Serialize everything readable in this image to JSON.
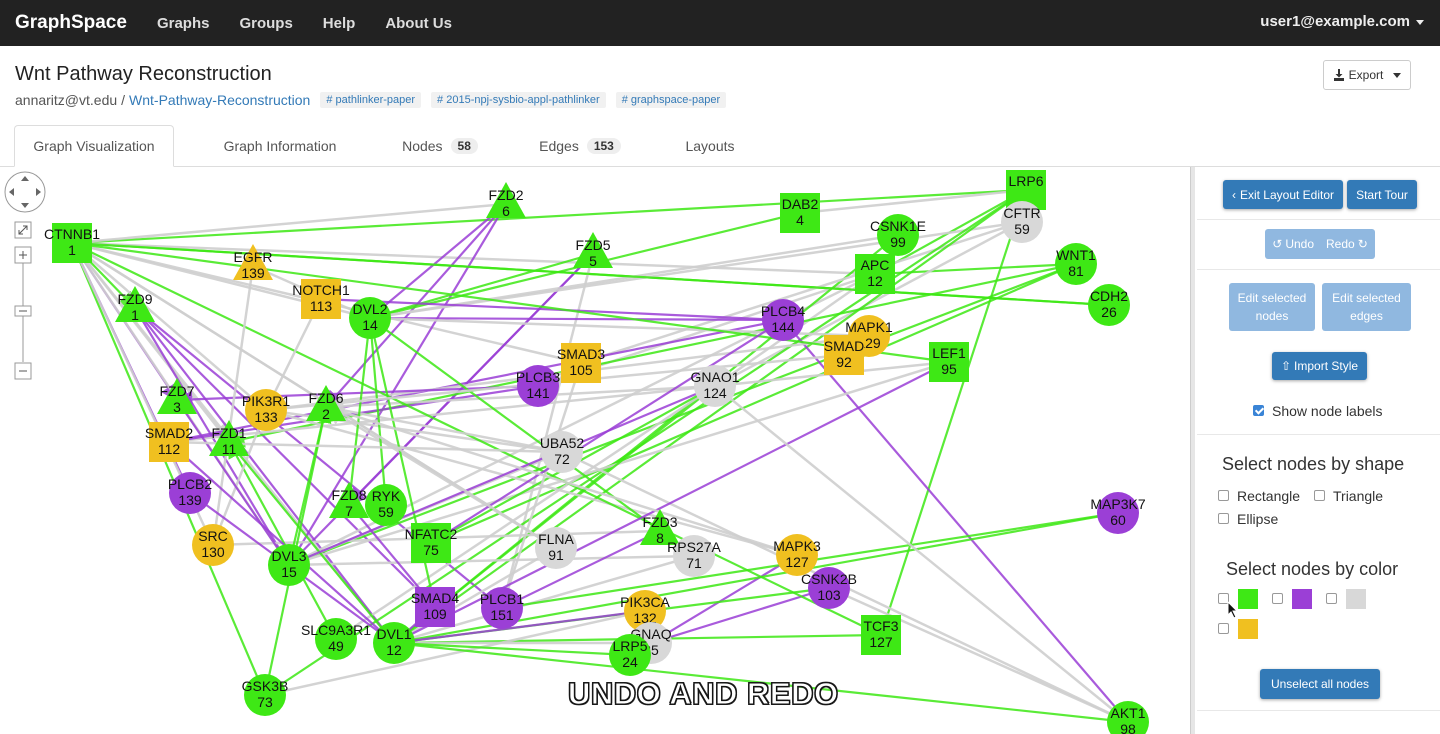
{
  "nav": {
    "brand": "GraphSpace",
    "links": [
      "Graphs",
      "Groups",
      "Help",
      "About Us"
    ],
    "user": "user1@example.com"
  },
  "header": {
    "title": "Wnt Pathway Reconstruction",
    "owner": "annaritz@vt.edu",
    "separator": "/",
    "graph_link": "Wnt-Pathway-Reconstruction",
    "tags": [
      "pathlinker-paper",
      "2015-npj-sysbio-appl-pathlinker",
      "graphspace-paper"
    ],
    "export_label": "Export"
  },
  "tabs": {
    "viz": "Graph Visualization",
    "info": "Graph Information",
    "nodes": "Nodes",
    "nodes_count": "58",
    "edges": "Edges",
    "edges_count": "153",
    "layouts": "Layouts"
  },
  "panel": {
    "exit_layout": "Exit Layout Editor",
    "start_tour": "Start Tour",
    "undo": "Undo",
    "redo": "Redo",
    "edit_nodes": "Edit selected nodes",
    "edit_edges": "Edit selected edges",
    "import_style": "Import Style",
    "show_labels": "Show node labels",
    "shape_title": "Select nodes by shape",
    "shape_rect": "Rectangle",
    "shape_tri": "Triangle",
    "shape_ellipse": "Ellipse",
    "color_title": "Select nodes by color",
    "colors": [
      "#3ee815",
      "#9b3fd6",
      "#d8d8d8",
      "#f0c020"
    ],
    "unselect": "Unselect all nodes"
  },
  "overlay": "UNDO AND REDO",
  "graph": {
    "colors": {
      "green": "#3ee815",
      "purple": "#9b3fd6",
      "gray": "#d8d8d8",
      "yellow": "#f0c020"
    },
    "nodes": [
      {
        "id": "CTNNB1",
        "num": "1",
        "shape": "rect",
        "color": "green"
      },
      {
        "id": "FZD2",
        "num": "6",
        "shape": "tri",
        "color": "green"
      },
      {
        "id": "DAB2",
        "num": "4",
        "shape": "rect",
        "color": "green"
      },
      {
        "id": "LRP6",
        "num": "",
        "shape": "rect",
        "color": "green"
      },
      {
        "id": "CFTR",
        "num": "59",
        "shape": "ellipse",
        "color": "gray"
      },
      {
        "id": "CSNK1E",
        "num": "99",
        "shape": "ellipse",
        "color": "green"
      },
      {
        "id": "EGFR",
        "num": "139",
        "shape": "tri",
        "color": "yellow"
      },
      {
        "id": "FZD5",
        "num": "5",
        "shape": "tri",
        "color": "green"
      },
      {
        "id": "APC",
        "num": "12",
        "shape": "rect",
        "color": "green"
      },
      {
        "id": "WNT1",
        "num": "81",
        "shape": "ellipse",
        "color": "green"
      },
      {
        "id": "FZD9",
        "num": "1",
        "shape": "tri",
        "color": "green"
      },
      {
        "id": "NOTCH1",
        "num": "113",
        "shape": "rect",
        "color": "yellow"
      },
      {
        "id": "DVL2",
        "num": "14",
        "shape": "ellipse",
        "color": "green"
      },
      {
        "id": "CDH2",
        "num": "26",
        "shape": "ellipse",
        "color": "green"
      },
      {
        "id": "PLCB4",
        "num": "144",
        "shape": "ellipse",
        "color": "purple"
      },
      {
        "id": "MAPK1",
        "num": "129",
        "shape": "ellipse",
        "color": "yellow"
      },
      {
        "id": "SMAD3",
        "num": "105",
        "shape": "rect",
        "color": "yellow"
      },
      {
        "id": "SMAD",
        "num": "92",
        "shape": "rect",
        "color": "yellow"
      },
      {
        "id": "LEF1",
        "num": "95",
        "shape": "rect",
        "color": "green"
      },
      {
        "id": "PLCB3",
        "num": "141",
        "shape": "ellipse",
        "color": "purple"
      },
      {
        "id": "GNAO1",
        "num": "124",
        "shape": "ellipse",
        "color": "gray"
      },
      {
        "id": "FZD7",
        "num": "3",
        "shape": "tri",
        "color": "green"
      },
      {
        "id": "PIK3R1",
        "num": "133",
        "shape": "ellipse",
        "color": "yellow"
      },
      {
        "id": "FZD6",
        "num": "2",
        "shape": "tri",
        "color": "green"
      },
      {
        "id": "SMAD2",
        "num": "112",
        "shape": "rect",
        "color": "yellow"
      },
      {
        "id": "FZD1",
        "num": "11",
        "shape": "tri",
        "color": "green"
      },
      {
        "id": "UBA52",
        "num": "72",
        "shape": "ellipse",
        "color": "gray"
      },
      {
        "id": "PLCB2",
        "num": "139",
        "shape": "ellipse",
        "color": "purple"
      },
      {
        "id": "FZD8",
        "num": "7",
        "shape": "tri",
        "color": "green"
      },
      {
        "id": "RYK",
        "num": "59",
        "shape": "ellipse",
        "color": "green"
      },
      {
        "id": "MAP3K7",
        "num": "60",
        "shape": "ellipse",
        "color": "purple"
      },
      {
        "id": "SRC",
        "num": "130",
        "shape": "ellipse",
        "color": "yellow"
      },
      {
        "id": "NFATC2",
        "num": "75",
        "shape": "rect",
        "color": "green"
      },
      {
        "id": "FLNA",
        "num": "91",
        "shape": "ellipse",
        "color": "gray"
      },
      {
        "id": "FZD3",
        "num": "8",
        "shape": "tri",
        "color": "green"
      },
      {
        "id": "DVL3",
        "num": "15",
        "shape": "ellipse",
        "color": "green"
      },
      {
        "id": "RPS27A",
        "num": "71",
        "shape": "ellipse",
        "color": "gray"
      },
      {
        "id": "MAPK3",
        "num": "127",
        "shape": "ellipse",
        "color": "yellow"
      },
      {
        "id": "CSNK2B",
        "num": "103",
        "shape": "ellipse",
        "color": "purple"
      },
      {
        "id": "SMAD4",
        "num": "109",
        "shape": "rect",
        "color": "purple"
      },
      {
        "id": "PLCB1",
        "num": "151",
        "shape": "ellipse",
        "color": "purple"
      },
      {
        "id": "PIK3CA",
        "num": "132",
        "shape": "ellipse",
        "color": "yellow"
      },
      {
        "id": "SLC9A3R1",
        "num": "49",
        "shape": "ellipse",
        "color": "green"
      },
      {
        "id": "DVL1",
        "num": "12",
        "shape": "ellipse",
        "color": "green"
      },
      {
        "id": "GNAQ",
        "num": "35",
        "shape": "ellipse",
        "color": "gray"
      },
      {
        "id": "TCF3",
        "num": "127",
        "shape": "rect",
        "color": "green"
      },
      {
        "id": "LRP5",
        "num": "24",
        "shape": "ellipse",
        "color": "green"
      },
      {
        "id": "GSK3B",
        "num": "73",
        "shape": "ellipse",
        "color": "green"
      },
      {
        "id": "AKT1",
        "num": "98",
        "shape": "ellipse",
        "color": "green"
      }
    ]
  }
}
